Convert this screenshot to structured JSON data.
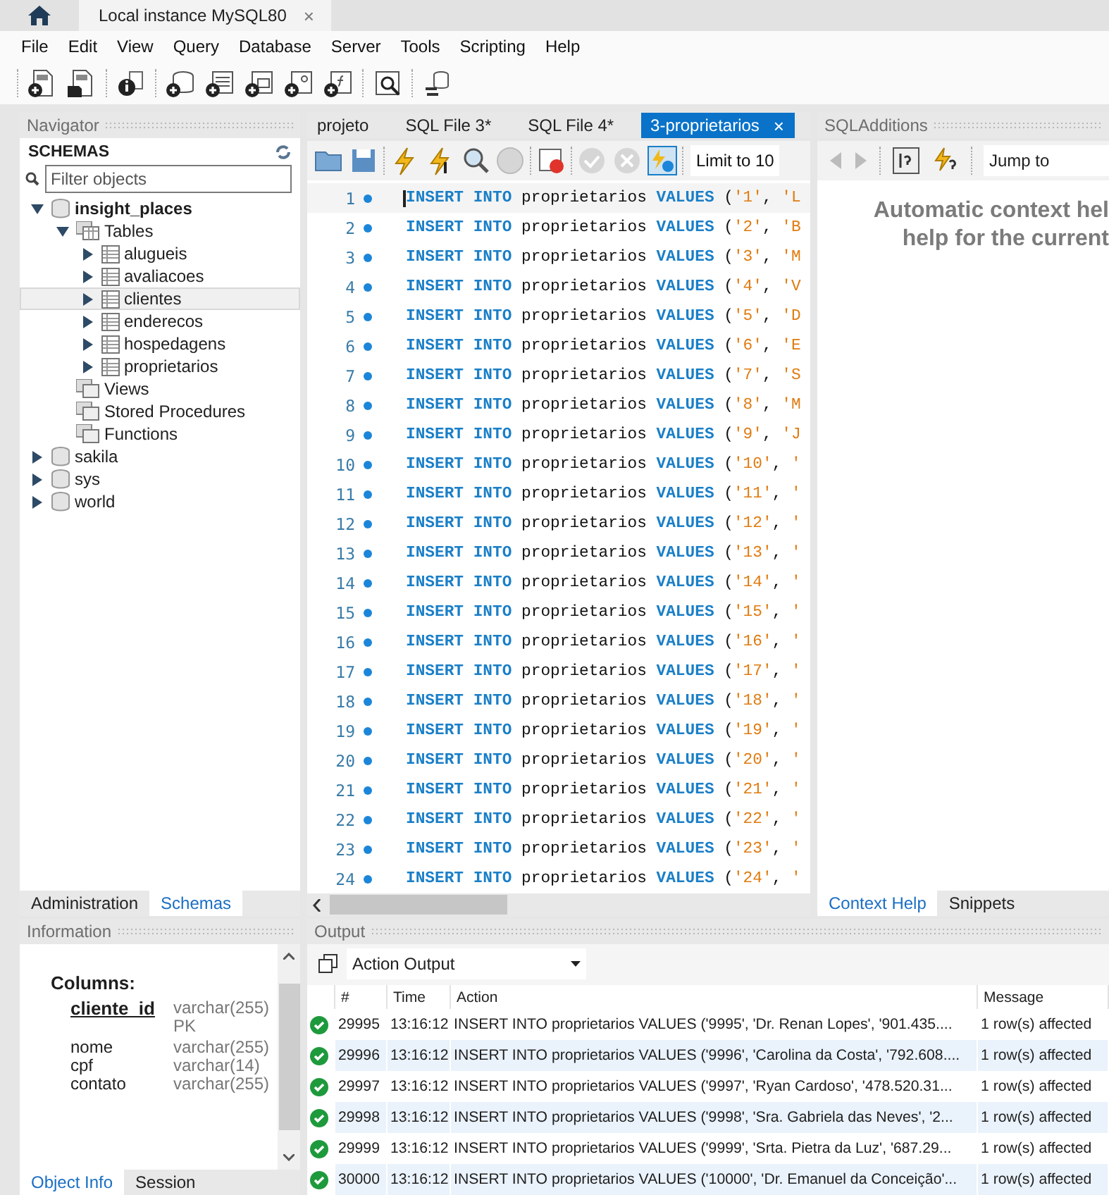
{
  "title_bar": {
    "tab": "Local instance MySQL80",
    "close": "×"
  },
  "menu": [
    "File",
    "Edit",
    "View",
    "Query",
    "Database",
    "Server",
    "Tools",
    "Scripting",
    "Help"
  ],
  "navigator": {
    "title": "Navigator",
    "section": "SCHEMAS",
    "filter": {
      "placeholder": "Filter objects"
    },
    "tree": [
      {
        "name": "insight_places",
        "kind": "schema",
        "expanded": true,
        "selected": false,
        "children": [
          {
            "name": "Tables",
            "kind": "folder",
            "expanded": true,
            "selected": false,
            "children": [
              {
                "name": "alugueis",
                "kind": "table",
                "expanded": false,
                "selected": false
              },
              {
                "name": "avaliacoes",
                "kind": "table",
                "expanded": false,
                "selected": false
              },
              {
                "name": "clientes",
                "kind": "table",
                "expanded": false,
                "selected": true
              },
              {
                "name": "enderecos",
                "kind": "table",
                "expanded": false,
                "selected": false
              },
              {
                "name": "hospedagens",
                "kind": "table",
                "expanded": false,
                "selected": false
              },
              {
                "name": "proprietarios",
                "kind": "table",
                "expanded": false,
                "selected": false
              }
            ]
          },
          {
            "name": "Views",
            "kind": "group",
            "selected": false
          },
          {
            "name": "Stored Procedures",
            "kind": "group",
            "selected": false
          },
          {
            "name": "Functions",
            "kind": "group",
            "selected": false
          }
        ]
      },
      {
        "name": "sakila",
        "kind": "schema",
        "expanded": false,
        "selected": false
      },
      {
        "name": "sys",
        "kind": "schema",
        "expanded": false,
        "selected": false
      },
      {
        "name": "world",
        "kind": "schema",
        "expanded": false,
        "selected": false
      }
    ],
    "tabs": [
      {
        "label": "Administration",
        "selected": false
      },
      {
        "label": "Schemas",
        "selected": true
      }
    ]
  },
  "editor": {
    "tabs": [
      {
        "label": "projeto",
        "selected": false
      },
      {
        "label": "SQL File 3*",
        "selected": false
      },
      {
        "label": "SQL File 4*",
        "selected": false
      },
      {
        "label": "3-proprietarios",
        "selected": true,
        "close": "×"
      }
    ],
    "limit": "Limit to 10",
    "lines": [
      {
        "number": "1",
        "current": true,
        "statement": "INSERT INTO",
        "table": "proprietarios",
        "clause": "VALUES",
        "open": "(",
        "id": "'1'",
        "separator": ",",
        "next": "'L"
      },
      {
        "number": "2",
        "current": false,
        "statement": "INSERT INTO",
        "table": "proprietarios",
        "clause": "VALUES",
        "open": "(",
        "id": "'2'",
        "separator": ",",
        "next": "'B"
      },
      {
        "number": "3",
        "current": false,
        "statement": "INSERT INTO",
        "table": "proprietarios",
        "clause": "VALUES",
        "open": "(",
        "id": "'3'",
        "separator": ",",
        "next": "'M"
      },
      {
        "number": "4",
        "current": false,
        "statement": "INSERT INTO",
        "table": "proprietarios",
        "clause": "VALUES",
        "open": "(",
        "id": "'4'",
        "separator": ",",
        "next": "'V"
      },
      {
        "number": "5",
        "current": false,
        "statement": "INSERT INTO",
        "table": "proprietarios",
        "clause": "VALUES",
        "open": "(",
        "id": "'5'",
        "separator": ",",
        "next": "'D"
      },
      {
        "number": "6",
        "current": false,
        "statement": "INSERT INTO",
        "table": "proprietarios",
        "clause": "VALUES",
        "open": "(",
        "id": "'6'",
        "separator": ",",
        "next": "'E"
      },
      {
        "number": "7",
        "current": false,
        "statement": "INSERT INTO",
        "table": "proprietarios",
        "clause": "VALUES",
        "open": "(",
        "id": "'7'",
        "separator": ",",
        "next": "'S"
      },
      {
        "number": "8",
        "current": false,
        "statement": "INSERT INTO",
        "table": "proprietarios",
        "clause": "VALUES",
        "open": "(",
        "id": "'8'",
        "separator": ",",
        "next": "'M"
      },
      {
        "number": "9",
        "current": false,
        "statement": "INSERT INTO",
        "table": "proprietarios",
        "clause": "VALUES",
        "open": "(",
        "id": "'9'",
        "separator": ",",
        "next": "'J"
      },
      {
        "number": "10",
        "current": false,
        "statement": "INSERT INTO",
        "table": "proprietarios",
        "clause": "VALUES",
        "open": "(",
        "id": "'10'",
        "separator": ",",
        "next": "'"
      },
      {
        "number": "11",
        "current": false,
        "statement": "INSERT INTO",
        "table": "proprietarios",
        "clause": "VALUES",
        "open": "(",
        "id": "'11'",
        "separator": ",",
        "next": "'"
      },
      {
        "number": "12",
        "current": false,
        "statement": "INSERT INTO",
        "table": "proprietarios",
        "clause": "VALUES",
        "open": "(",
        "id": "'12'",
        "separator": ",",
        "next": "'"
      },
      {
        "number": "13",
        "current": false,
        "statement": "INSERT INTO",
        "table": "proprietarios",
        "clause": "VALUES",
        "open": "(",
        "id": "'13'",
        "separator": ",",
        "next": "'"
      },
      {
        "number": "14",
        "current": false,
        "statement": "INSERT INTO",
        "table": "proprietarios",
        "clause": "VALUES",
        "open": "(",
        "id": "'14'",
        "separator": ",",
        "next": "'"
      },
      {
        "number": "15",
        "current": false,
        "statement": "INSERT INTO",
        "table": "proprietarios",
        "clause": "VALUES",
        "open": "(",
        "id": "'15'",
        "separator": ",",
        "next": "'"
      },
      {
        "number": "16",
        "current": false,
        "statement": "INSERT INTO",
        "table": "proprietarios",
        "clause": "VALUES",
        "open": "(",
        "id": "'16'",
        "separator": ",",
        "next": "'"
      },
      {
        "number": "17",
        "current": false,
        "statement": "INSERT INTO",
        "table": "proprietarios",
        "clause": "VALUES",
        "open": "(",
        "id": "'17'",
        "separator": ",",
        "next": "'"
      },
      {
        "number": "18",
        "current": false,
        "statement": "INSERT INTO",
        "table": "proprietarios",
        "clause": "VALUES",
        "open": "(",
        "id": "'18'",
        "separator": ",",
        "next": "'"
      },
      {
        "number": "19",
        "current": false,
        "statement": "INSERT INTO",
        "table": "proprietarios",
        "clause": "VALUES",
        "open": "(",
        "id": "'19'",
        "separator": ",",
        "next": "'"
      },
      {
        "number": "20",
        "current": false,
        "statement": "INSERT INTO",
        "table": "proprietarios",
        "clause": "VALUES",
        "open": "(",
        "id": "'20'",
        "separator": ",",
        "next": "'"
      },
      {
        "number": "21",
        "current": false,
        "statement": "INSERT INTO",
        "table": "proprietarios",
        "clause": "VALUES",
        "open": "(",
        "id": "'21'",
        "separator": ",",
        "next": "'"
      },
      {
        "number": "22",
        "current": false,
        "statement": "INSERT INTO",
        "table": "proprietarios",
        "clause": "VALUES",
        "open": "(",
        "id": "'22'",
        "separator": ",",
        "next": "'"
      },
      {
        "number": "23",
        "current": false,
        "statement": "INSERT INTO",
        "table": "proprietarios",
        "clause": "VALUES",
        "open": "(",
        "id": "'23'",
        "separator": ",",
        "next": "'"
      },
      {
        "number": "24",
        "current": false,
        "statement": "INSERT INTO",
        "table": "proprietarios",
        "clause": "VALUES",
        "open": "(",
        "id": "'24'",
        "separator": ",",
        "next": "'"
      }
    ]
  },
  "sql_additions": {
    "title": "SQLAdditions",
    "jump_to": "Jump to",
    "help": [
      "Automatic context hel",
      "help for the current"
    ],
    "tabs": [
      {
        "label": "Context Help",
        "selected": true
      },
      {
        "label": "Snippets",
        "selected": false
      }
    ]
  },
  "information": {
    "title": "Information",
    "heading": "Columns:",
    "columns": [
      {
        "name": "cliente_id",
        "type": "varchar(255)",
        "key": "PK",
        "primary": true
      },
      {
        "name": "nome",
        "type": "varchar(255)",
        "primary": false
      },
      {
        "name": "cpf",
        "type": "varchar(14)",
        "primary": false
      },
      {
        "name": "contato",
        "type": "varchar(255)",
        "primary": false
      }
    ],
    "tabs": [
      {
        "label": "Object Info",
        "selected": true
      },
      {
        "label": "Session",
        "selected": false
      }
    ]
  },
  "output": {
    "title": "Output",
    "selector": "Action Output",
    "columns": [
      "#",
      "Time",
      "Action",
      "Message"
    ],
    "rows": [
      {
        "success": true,
        "number": "29995",
        "time": "13:16:12",
        "action": "INSERT INTO proprietarios VALUES ('9995', 'Dr. Renan Lopes', '901.435....",
        "message": "1 row(s) affected"
      },
      {
        "success": true,
        "number": "29996",
        "time": "13:16:12",
        "action": "INSERT INTO proprietarios VALUES ('9996', 'Carolina da Costa', '792.608....",
        "message": "1 row(s) affected"
      },
      {
        "success": true,
        "number": "29997",
        "time": "13:16:12",
        "action": "INSERT INTO proprietarios VALUES ('9997', 'Ryan Cardoso', '478.520.31...",
        "message": "1 row(s) affected"
      },
      {
        "success": true,
        "number": "29998",
        "time": "13:16:12",
        "action": "INSERT INTO proprietarios VALUES ('9998', 'Sra. Gabriela das Neves', '2...",
        "message": "1 row(s) affected"
      },
      {
        "success": true,
        "number": "29999",
        "time": "13:16:12",
        "action": "INSERT INTO proprietarios VALUES ('9999', 'Srta. Pietra da Luz', '687.29...",
        "message": "1 row(s) affected"
      },
      {
        "success": true,
        "number": "30000",
        "time": "13:16:12",
        "action": "INSERT INTO proprietarios VALUES ('10000', 'Dr. Emanuel da Conceição'...",
        "message": "1 row(s) affected"
      }
    ]
  }
}
